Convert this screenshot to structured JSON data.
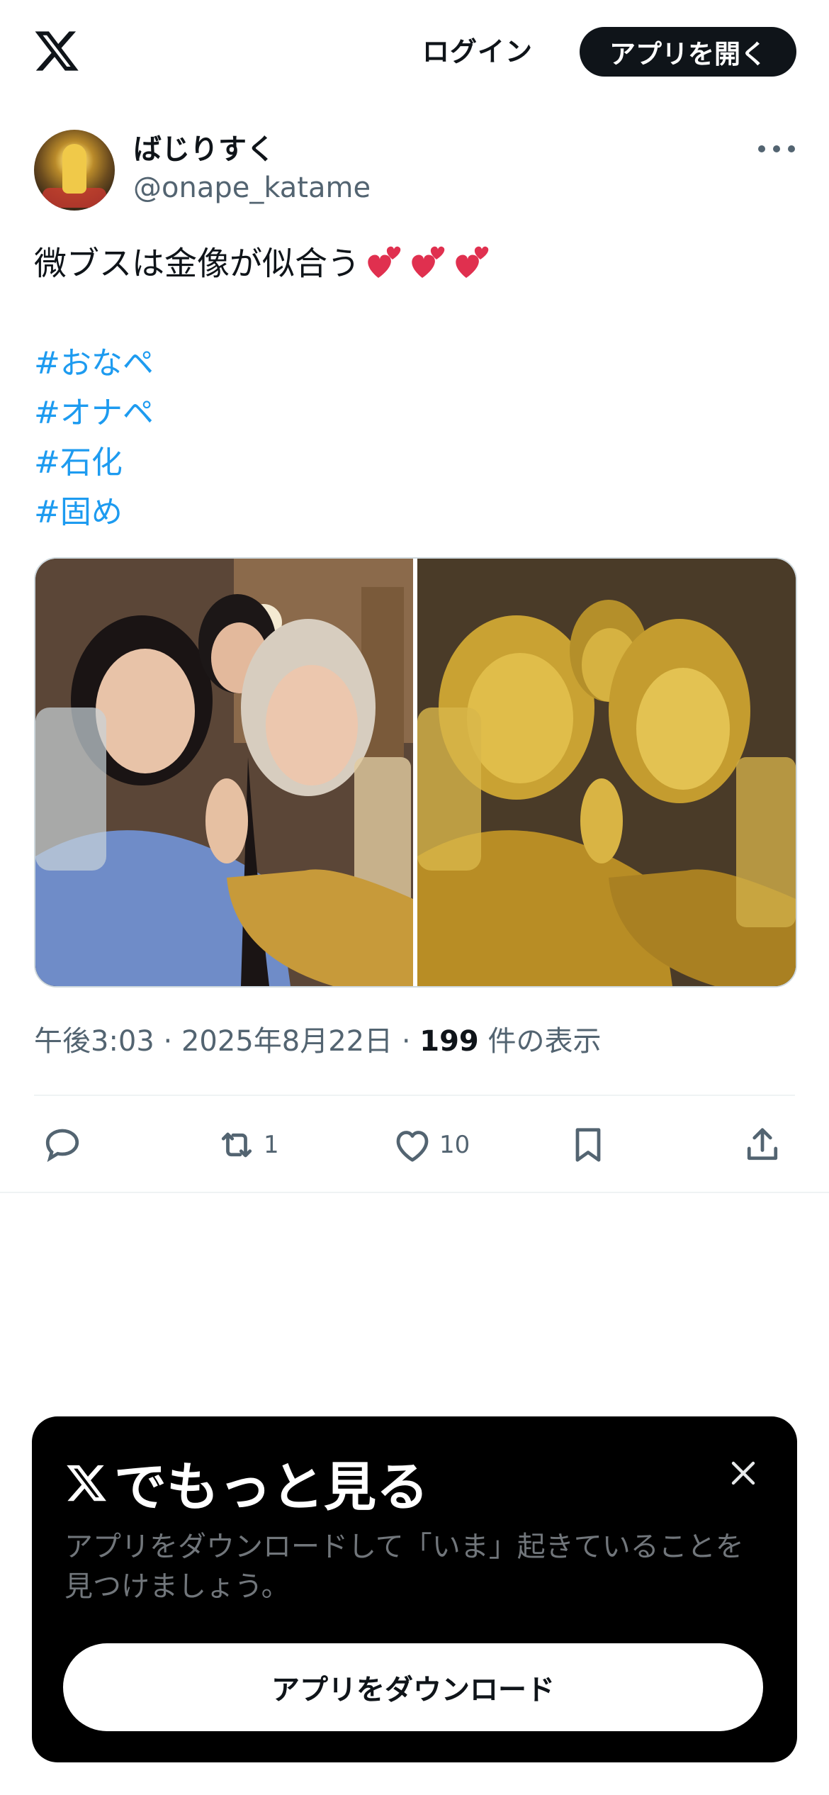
{
  "header": {
    "logo_icon": "x-logo-icon",
    "login_label": "ログイン",
    "open_app_label": "アプリを開く"
  },
  "tweet": {
    "author": {
      "display_name": "ばじりすく",
      "handle": "@onape_katame"
    },
    "more_icon": "more-dots-icon",
    "text": "微ブスは金像が似合う",
    "emoji": [
      "two-hearts",
      "two-hearts",
      "two-hearts"
    ],
    "hashtags": [
      "#おなペ",
      "#オナペ",
      "#石化",
      "#固め"
    ],
    "media": [
      {
        "icon": "photo-selfie-three-women"
      },
      {
        "icon": "photo-golden-statues-three-women"
      }
    ],
    "meta": {
      "time": "午後3:03 · 2025年8月22日 · ",
      "views": "199",
      "views_suffix": " 件の表示"
    },
    "actions": {
      "reply_icon": "reply-icon",
      "retweet_icon": "retweet-icon",
      "retweet_count": "1",
      "like_icon": "heart-icon",
      "like_count": "10",
      "bookmark_icon": "bookmark-icon",
      "share_icon": "share-icon"
    }
  },
  "sheet": {
    "title": "でもっと見る",
    "description": "アプリをダウンロードして「いま」起きていることを見つけましょう。",
    "download_label": "アプリをダウンロード",
    "close_icon": "close-icon"
  }
}
